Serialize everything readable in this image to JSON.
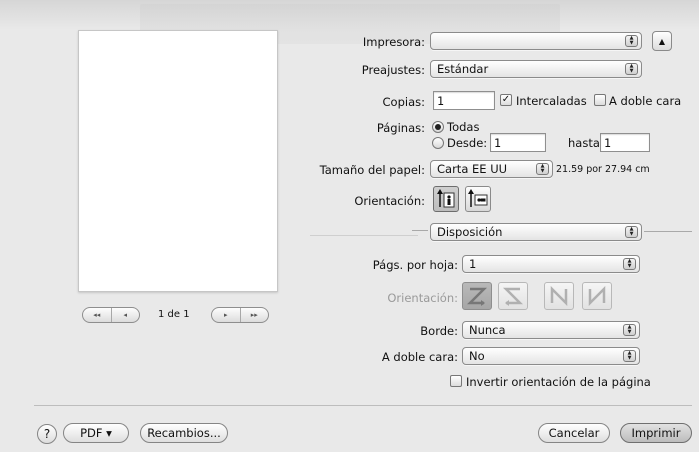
{
  "preview": {
    "page_indicator": "1 de 1",
    "first_label": "◂◂",
    "prev_label": "◂",
    "next_label": "▸",
    "last_label": "▸▸"
  },
  "printer": {
    "label": "Impresora:",
    "value": ""
  },
  "presets": {
    "label": "Preajustes:",
    "value": "Estándar"
  },
  "copies": {
    "label": "Copias:",
    "value": "1",
    "collated_label": "Intercaladas",
    "collated_checked": true,
    "duplex_label": "A doble cara",
    "duplex_checked": false
  },
  "pages": {
    "label": "Páginas:",
    "all_label": "Todas",
    "all_selected": true,
    "from_label": "Desde:",
    "from_value": "1",
    "to_label": "hasta:",
    "to_value": "1"
  },
  "paper_size": {
    "label": "Tamaño del papel:",
    "value": "Carta EE UU",
    "dimensions": "21.59 por 27.94 cm"
  },
  "orientation": {
    "label": "Orientación:",
    "selected": "portrait"
  },
  "section_popup": {
    "value": "Disposición"
  },
  "pages_per_sheet": {
    "label": "Págs. por hoja:",
    "value": "1"
  },
  "layout_direction": {
    "label": "Orientación:",
    "options": [
      "Z",
      "S",
      "N-reversed",
      "N"
    ],
    "selected_index": 0
  },
  "border": {
    "label": "Borde:",
    "value": "Nunca"
  },
  "two_sided": {
    "label": "A doble cara:",
    "value": "No"
  },
  "reverse_orientation": {
    "label": "Invertir orientación de la página",
    "checked": false
  },
  "footer": {
    "help_label": "?",
    "pdf_label": "PDF ▾",
    "supplies_label": "Recambios...",
    "cancel_label": "Cancelar",
    "print_label": "Imprimir"
  }
}
